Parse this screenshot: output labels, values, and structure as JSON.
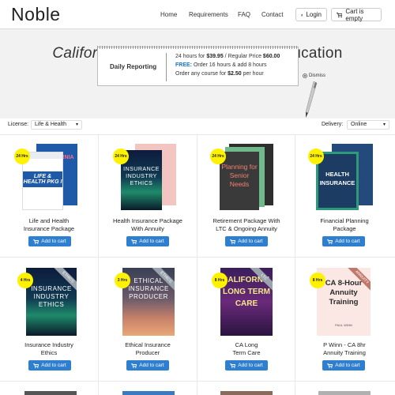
{
  "header": {
    "logo": "Noble",
    "nav": [
      "Home",
      "Requirements",
      "FAQ",
      "Contact"
    ],
    "login_label": "Login",
    "cart_label": "Cart is empty"
  },
  "hero": {
    "title_italic": "California",
    "title_rest": "Insurance Continuing Education",
    "notepad_label": "Daily Reporting",
    "line1_pre": "24 hours for ",
    "line1_price": "$39.95",
    "line1_mid": " / Regular Price ",
    "line1_regular": "$60.00",
    "line2_free": "FREE:",
    "line2_rest": " Order 16 hours & add 8 hours",
    "line3_pre": "Order any course for ",
    "line3_price": "$2.50",
    "line3_post": " per hour",
    "dismiss_label": "Dismiss"
  },
  "filters": {
    "license_label": "License:",
    "license_value": "Life & Health",
    "delivery_label": "Delivery:",
    "delivery_value": "Online"
  },
  "products": [
    {
      "badge": "24 Hrs",
      "title_line1": "Life and Health",
      "title_line2": "Insurance Package",
      "cover_text": "LIFE & HEALTH PKG I",
      "back_text": "CALIFORNIA"
    },
    {
      "badge": "24 Hrs",
      "title_line1": "Health Insurance Package",
      "title_line2": "With Annuity",
      "cover_text": "INSURANCE INDUSTRY ETHICS"
    },
    {
      "badge": "24 Hrs",
      "title_line1": "Retirement Package With",
      "title_line2": "LTC & Ongoing Annuity",
      "cover_text": "Planning for Senior Needs"
    },
    {
      "badge": "24 Hrs",
      "title_line1": "Financial Planning",
      "title_line2": "Package",
      "cover_text": "HEALTH INSURANCE"
    },
    {
      "badge": "4 Hrs",
      "title_line1": "Insurance Industry",
      "title_line2": "Ethics",
      "cover_text": "INSURANCE INDUSTRY ETHICS",
      "ribbon": "ETHICS"
    },
    {
      "badge": "3 Hrs",
      "title_line1": "Ethical Insurance",
      "title_line2": "Producer",
      "cover_text": "ETHICAL INSURANCE PRODUCER",
      "ribbon": "ETHICS"
    },
    {
      "badge": "8 Hrs",
      "title_line1": "CA Long",
      "title_line2": "Term Care",
      "cover_text": "CALIFORNIA LONG TERM CARE",
      "ribbon": "LTC"
    },
    {
      "badge": "8 Hrs",
      "title_line1": "P Winn - CA 8hr",
      "title_line2": "Annuity Training",
      "cover_text": "CA 8-Hour Annuity Training",
      "ribbon": "ANNUITY",
      "author": "PAUL WINN"
    }
  ],
  "add_to_cart_label": "Add to cart",
  "colors": {
    "accent": "#2f7fd0",
    "badge": "#fff200",
    "hero_bg": "#f2f2f2"
  }
}
